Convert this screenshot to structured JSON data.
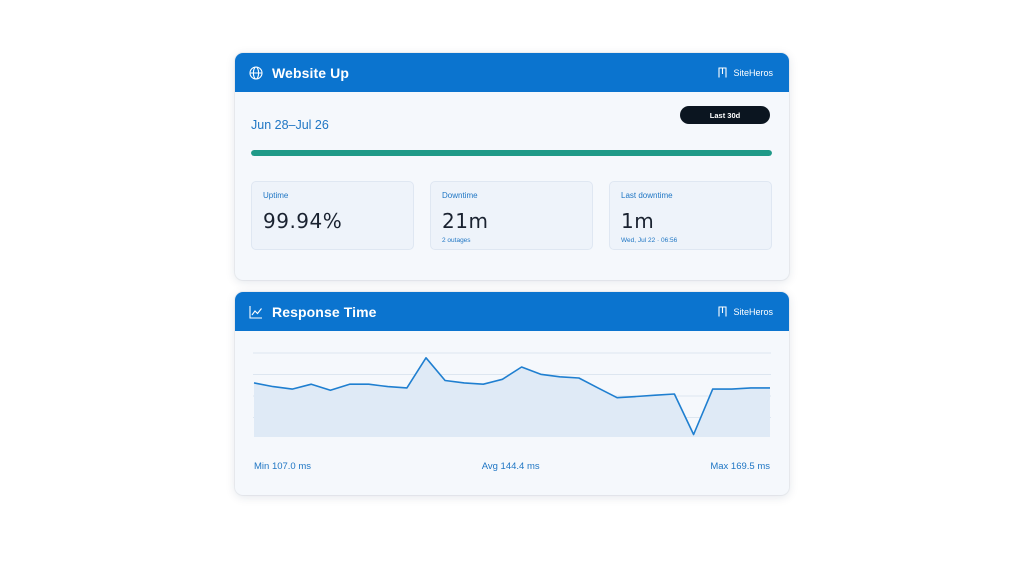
{
  "uptime_card": {
    "title": "Website Up",
    "brand": "SiteHeros",
    "date_range": "Jun 28–Jul 26",
    "range_badge": "Last 30d",
    "uptime_fraction": 0.9994,
    "stats": [
      {
        "label": "Uptime",
        "value": "99.94%",
        "sub": ""
      },
      {
        "label": "Downtime",
        "value": "21m",
        "sub": "2 outages"
      },
      {
        "label": "Last downtime",
        "value": "1m",
        "sub": "Wed, Jul 22 · 06:56"
      }
    ]
  },
  "response_card": {
    "title": "Response Time",
    "brand": "SiteHeros",
    "min_label": "Min 107.0 ms",
    "avg_label": "Avg 144.4 ms",
    "max_label": "Max 169.5 ms"
  },
  "colors": {
    "header": "#0b74cf",
    "accent_text": "#1f76c4",
    "uptime_bar": "#1f9a88",
    "line": "#1f7fd0"
  },
  "icons": {
    "uptime_header": "globe-icon",
    "response_header": "line-chart-icon",
    "brand": "bars-logo-icon"
  },
  "chart_data": {
    "type": "area",
    "x": [
      1,
      2,
      3,
      4,
      5,
      6,
      7,
      8,
      9,
      10,
      11,
      12,
      13,
      14,
      15,
      16,
      17,
      18,
      19,
      20,
      21,
      22,
      23,
      24,
      25,
      26,
      27,
      28
    ],
    "values": [
      149,
      146,
      144,
      148,
      143,
      148,
      148,
      146,
      145,
      169.5,
      151,
      149,
      148,
      152,
      162,
      156,
      154,
      153,
      145,
      137,
      138,
      139,
      140,
      107,
      144,
      144,
      145,
      145
    ],
    "ylim": [
      105,
      175
    ],
    "grid": true
  }
}
